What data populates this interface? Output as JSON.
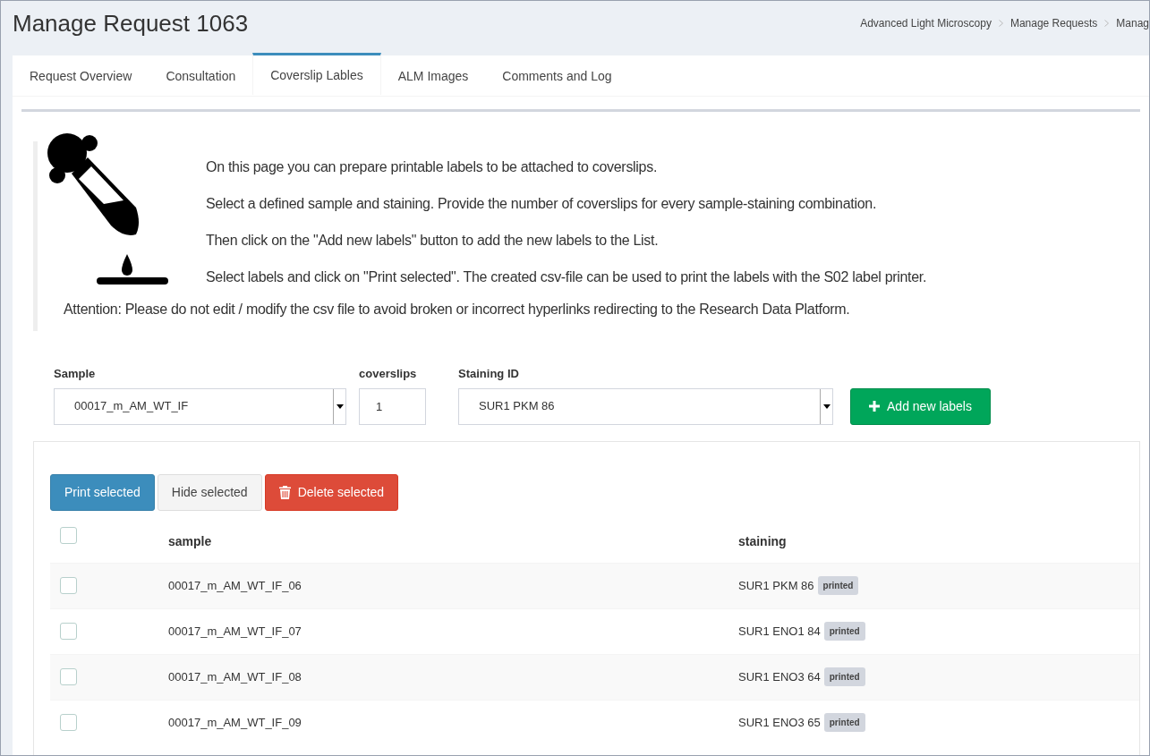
{
  "page_title": "Manage Request 1063",
  "breadcrumb": [
    "Advanced Light Microscopy",
    "Manage Requests",
    "Manag"
  ],
  "tabs": [
    {
      "label": "Request Overview",
      "selected": false
    },
    {
      "label": "Consultation",
      "selected": false
    },
    {
      "label": "Coverslip Lables",
      "selected": true
    },
    {
      "label": "ALM Images",
      "selected": false
    },
    {
      "label": "Comments and Log",
      "selected": false
    }
  ],
  "info": {
    "lines": [
      "On this page you can prepare printable labels to be attached to coverslips.",
      "Select a defined sample and staining. Provide the number of coverslips for every sample-staining combination.",
      "Then click on the \"Add new labels\" button to add the new labels to the List.",
      "Select labels and click on \"Print selected\". The created csv-file can be used to print the labels with the S02 label printer."
    ],
    "attention": "Attention: Please do not edit / modify the csv file to avoid broken or incorrect hyperlinks redirecting to the Research Data Platform."
  },
  "form": {
    "sample": {
      "label": "Sample",
      "value": "00017_m_AM_WT_IF"
    },
    "coverslips": {
      "label": "coverslips",
      "value": "1"
    },
    "staining": {
      "label": "Staining ID",
      "value": "SUR1 PKM 86"
    },
    "add_button": "Add new labels"
  },
  "actions": [
    {
      "label": "Print selected",
      "kind": "primary"
    },
    {
      "label": "Hide selected",
      "kind": "default"
    },
    {
      "label": "Delete selected",
      "kind": "danger"
    }
  ],
  "table": {
    "select_all": {
      "checked": false
    },
    "columns": [
      "sample",
      "staining"
    ],
    "rows": [
      {
        "checked": false,
        "sample": "00017_m_AM_WT_IF_06",
        "staining": "SUR1 PKM 86",
        "badge": "printed"
      },
      {
        "checked": false,
        "sample": "00017_m_AM_WT_IF_07",
        "staining": "SUR1 ENO1 84",
        "badge": "printed"
      },
      {
        "checked": false,
        "sample": "00017_m_AM_WT_IF_08",
        "staining": "SUR1 ENO3 64",
        "badge": "printed"
      },
      {
        "checked": false,
        "sample": "00017_m_AM_WT_IF_09",
        "staining": "SUR1 ENO3 65",
        "badge": "printed"
      }
    ]
  }
}
